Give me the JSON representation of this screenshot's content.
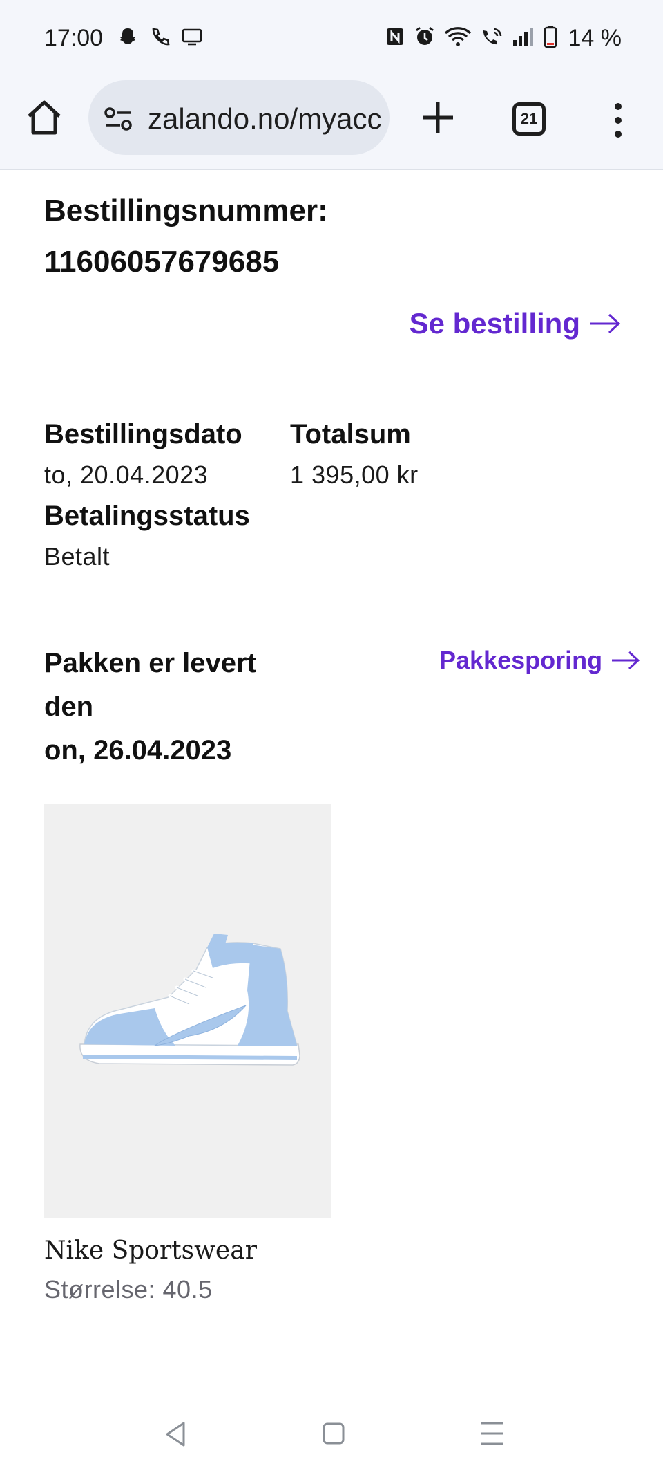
{
  "status_bar": {
    "time": "17:00",
    "battery": "14 %",
    "left_icons": [
      "snapchat-icon",
      "phone-icon",
      "screen-icon"
    ],
    "right_icons": [
      "nfc-icon",
      "alarm-icon",
      "wifi-icon",
      "wifi-call-icon",
      "signal-icon",
      "battery-icon"
    ]
  },
  "browser": {
    "url": "zalando.no/myaccount",
    "tab_count": "21"
  },
  "order": {
    "number_label": "Bestillingsnummer:",
    "number_value": "11606057679685",
    "see_order_label": "Se bestilling",
    "order_date_label": "Bestillingsdato",
    "order_date_value": "to, 20.04.2023",
    "total_label": "Totalsum",
    "total_value": "1 395,00 kr",
    "payment_status_label": "Betalingsstatus",
    "payment_status_value": "Betalt",
    "delivered_line1": "Pakken er levert",
    "delivered_line2": "den",
    "delivered_line3": "on, 26.04.2023",
    "tracking_label": "Pakkesporing"
  },
  "product": {
    "brand": "Nike Sportswear",
    "size": "Størrelse: 40.5",
    "colors": {
      "shoe_blue": "#a9c8ec",
      "card_bg": "#f0f0f0"
    }
  },
  "accent_color": "#6328d0"
}
